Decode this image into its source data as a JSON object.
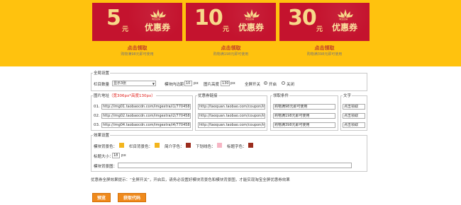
{
  "banner": {
    "background": "#ffc20e",
    "coupons": [
      {
        "amount": "5",
        "unit": "元",
        "label": "优惠券",
        "shop": "淘宝店铺",
        "claim": "点击领取",
        "desc": "购物满98元即可使用"
      },
      {
        "amount": "10",
        "unit": "元",
        "label": "优惠券",
        "shop": "淘宝店铺",
        "claim": "点击领取",
        "desc": "购物满198元即可使用"
      },
      {
        "amount": "30",
        "unit": "元",
        "label": "优惠券",
        "shop": "淘宝店铺",
        "claim": "点击领取",
        "desc": "购物满398元即可使用"
      }
    ]
  },
  "global": {
    "legend": "全局设置",
    "column_count_label": "栏目数量",
    "column_count_value": "显示3张",
    "padding_label": "模块内边距",
    "padding_value": "10",
    "padding_unit": "px",
    "height_label": "图片高度",
    "height_value": "130",
    "height_unit": "px",
    "fullscreen_label": "全屏开关",
    "on_label": "开启",
    "off_label": "关闭"
  },
  "images": {
    "legend": "图片地址",
    "size_hint": "（宽306px*高度130px）",
    "rows": [
      {
        "index": "01.",
        "url": "http://img01.taobaocdn.com/imgextra/i1/770458061/"
      },
      {
        "index": "02.",
        "url": "http://img02.taobaocdn.com/imgextra/i2/770458061/"
      },
      {
        "index": "03.",
        "url": "http://img04.taobaocdn.com/imgextra/i4/770458061/"
      }
    ]
  },
  "links": {
    "legend": "优惠券链接",
    "rows": [
      "http://taoquan.taobao.com/coupon/inde",
      "http://taoquan.taobao.com/coupon/inde",
      "http://taoquan.taobao.com/coupon/inde"
    ]
  },
  "conditions": {
    "legend": "领取条件",
    "rows": [
      "购物满98元即可使用",
      "购物满198元即可使用",
      "购物满398元即可使用"
    ]
  },
  "text": {
    "legend": "文字",
    "rows": [
      "点击领取",
      "点击领取",
      "点击领取"
    ]
  },
  "effects": {
    "legend": "效果设置",
    "module_bg_label": "模块背景色：",
    "module_bg_color": "#f3b51d",
    "column_bg_label": "栏目背景色：",
    "column_bg_color": "#f3b51d",
    "intro_color_label": "简介字色：",
    "intro_color": "#9b2d1e",
    "underline_color_label": "下划线色：",
    "underline_color": "#f6b5c4",
    "title_color_label": "标题字色：",
    "title_color": "#9b2d1e",
    "title_size_label": "标题大小：",
    "title_size_value": "18",
    "title_size_unit": "px",
    "bg_image_label": "模块背景图：",
    "bg_image_value": ""
  },
  "tip": "优惠券全屏效果提示：“全屏开关”，开启后，请务必设置好模块背景色和模块背景图，才能实现淘宝全屏优惠券效果",
  "buttons": {
    "preview": "预览",
    "get_code": "获取代码",
    "color": "#ef8a1c"
  }
}
